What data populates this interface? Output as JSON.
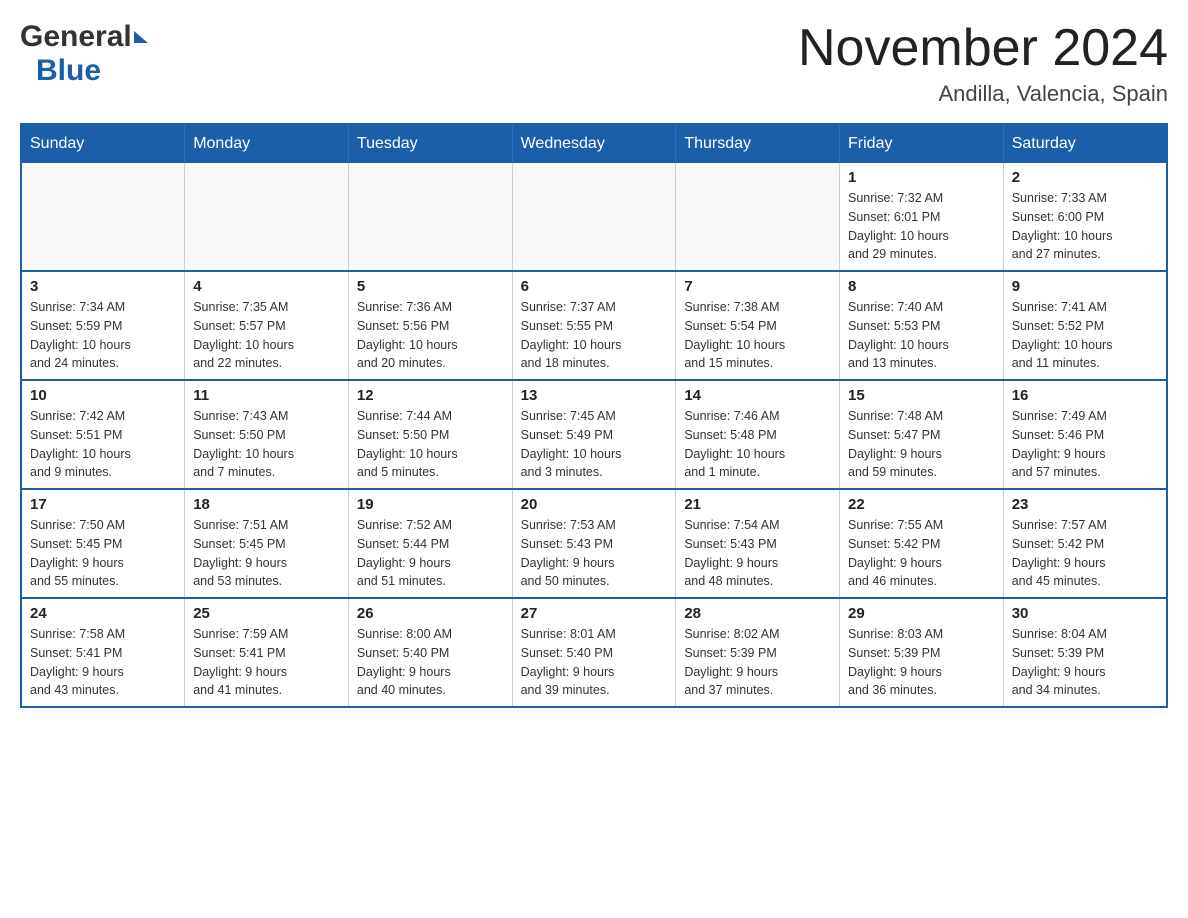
{
  "header": {
    "logo_general": "General",
    "logo_blue": "Blue",
    "month_title": "November 2024",
    "location": "Andilla, Valencia, Spain"
  },
  "days_of_week": [
    "Sunday",
    "Monday",
    "Tuesday",
    "Wednesday",
    "Thursday",
    "Friday",
    "Saturday"
  ],
  "weeks": [
    {
      "days": [
        {
          "number": "",
          "info": ""
        },
        {
          "number": "",
          "info": ""
        },
        {
          "number": "",
          "info": ""
        },
        {
          "number": "",
          "info": ""
        },
        {
          "number": "",
          "info": ""
        },
        {
          "number": "1",
          "info": "Sunrise: 7:32 AM\nSunset: 6:01 PM\nDaylight: 10 hours\nand 29 minutes."
        },
        {
          "number": "2",
          "info": "Sunrise: 7:33 AM\nSunset: 6:00 PM\nDaylight: 10 hours\nand 27 minutes."
        }
      ]
    },
    {
      "days": [
        {
          "number": "3",
          "info": "Sunrise: 7:34 AM\nSunset: 5:59 PM\nDaylight: 10 hours\nand 24 minutes."
        },
        {
          "number": "4",
          "info": "Sunrise: 7:35 AM\nSunset: 5:57 PM\nDaylight: 10 hours\nand 22 minutes."
        },
        {
          "number": "5",
          "info": "Sunrise: 7:36 AM\nSunset: 5:56 PM\nDaylight: 10 hours\nand 20 minutes."
        },
        {
          "number": "6",
          "info": "Sunrise: 7:37 AM\nSunset: 5:55 PM\nDaylight: 10 hours\nand 18 minutes."
        },
        {
          "number": "7",
          "info": "Sunrise: 7:38 AM\nSunset: 5:54 PM\nDaylight: 10 hours\nand 15 minutes."
        },
        {
          "number": "8",
          "info": "Sunrise: 7:40 AM\nSunset: 5:53 PM\nDaylight: 10 hours\nand 13 minutes."
        },
        {
          "number": "9",
          "info": "Sunrise: 7:41 AM\nSunset: 5:52 PM\nDaylight: 10 hours\nand 11 minutes."
        }
      ]
    },
    {
      "days": [
        {
          "number": "10",
          "info": "Sunrise: 7:42 AM\nSunset: 5:51 PM\nDaylight: 10 hours\nand 9 minutes."
        },
        {
          "number": "11",
          "info": "Sunrise: 7:43 AM\nSunset: 5:50 PM\nDaylight: 10 hours\nand 7 minutes."
        },
        {
          "number": "12",
          "info": "Sunrise: 7:44 AM\nSunset: 5:50 PM\nDaylight: 10 hours\nand 5 minutes."
        },
        {
          "number": "13",
          "info": "Sunrise: 7:45 AM\nSunset: 5:49 PM\nDaylight: 10 hours\nand 3 minutes."
        },
        {
          "number": "14",
          "info": "Sunrise: 7:46 AM\nSunset: 5:48 PM\nDaylight: 10 hours\nand 1 minute."
        },
        {
          "number": "15",
          "info": "Sunrise: 7:48 AM\nSunset: 5:47 PM\nDaylight: 9 hours\nand 59 minutes."
        },
        {
          "number": "16",
          "info": "Sunrise: 7:49 AM\nSunset: 5:46 PM\nDaylight: 9 hours\nand 57 minutes."
        }
      ]
    },
    {
      "days": [
        {
          "number": "17",
          "info": "Sunrise: 7:50 AM\nSunset: 5:45 PM\nDaylight: 9 hours\nand 55 minutes."
        },
        {
          "number": "18",
          "info": "Sunrise: 7:51 AM\nSunset: 5:45 PM\nDaylight: 9 hours\nand 53 minutes."
        },
        {
          "number": "19",
          "info": "Sunrise: 7:52 AM\nSunset: 5:44 PM\nDaylight: 9 hours\nand 51 minutes."
        },
        {
          "number": "20",
          "info": "Sunrise: 7:53 AM\nSunset: 5:43 PM\nDaylight: 9 hours\nand 50 minutes."
        },
        {
          "number": "21",
          "info": "Sunrise: 7:54 AM\nSunset: 5:43 PM\nDaylight: 9 hours\nand 48 minutes."
        },
        {
          "number": "22",
          "info": "Sunrise: 7:55 AM\nSunset: 5:42 PM\nDaylight: 9 hours\nand 46 minutes."
        },
        {
          "number": "23",
          "info": "Sunrise: 7:57 AM\nSunset: 5:42 PM\nDaylight: 9 hours\nand 45 minutes."
        }
      ]
    },
    {
      "days": [
        {
          "number": "24",
          "info": "Sunrise: 7:58 AM\nSunset: 5:41 PM\nDaylight: 9 hours\nand 43 minutes."
        },
        {
          "number": "25",
          "info": "Sunrise: 7:59 AM\nSunset: 5:41 PM\nDaylight: 9 hours\nand 41 minutes."
        },
        {
          "number": "26",
          "info": "Sunrise: 8:00 AM\nSunset: 5:40 PM\nDaylight: 9 hours\nand 40 minutes."
        },
        {
          "number": "27",
          "info": "Sunrise: 8:01 AM\nSunset: 5:40 PM\nDaylight: 9 hours\nand 39 minutes."
        },
        {
          "number": "28",
          "info": "Sunrise: 8:02 AM\nSunset: 5:39 PM\nDaylight: 9 hours\nand 37 minutes."
        },
        {
          "number": "29",
          "info": "Sunrise: 8:03 AM\nSunset: 5:39 PM\nDaylight: 9 hours\nand 36 minutes."
        },
        {
          "number": "30",
          "info": "Sunrise: 8:04 AM\nSunset: 5:39 PM\nDaylight: 9 hours\nand 34 minutes."
        }
      ]
    }
  ]
}
